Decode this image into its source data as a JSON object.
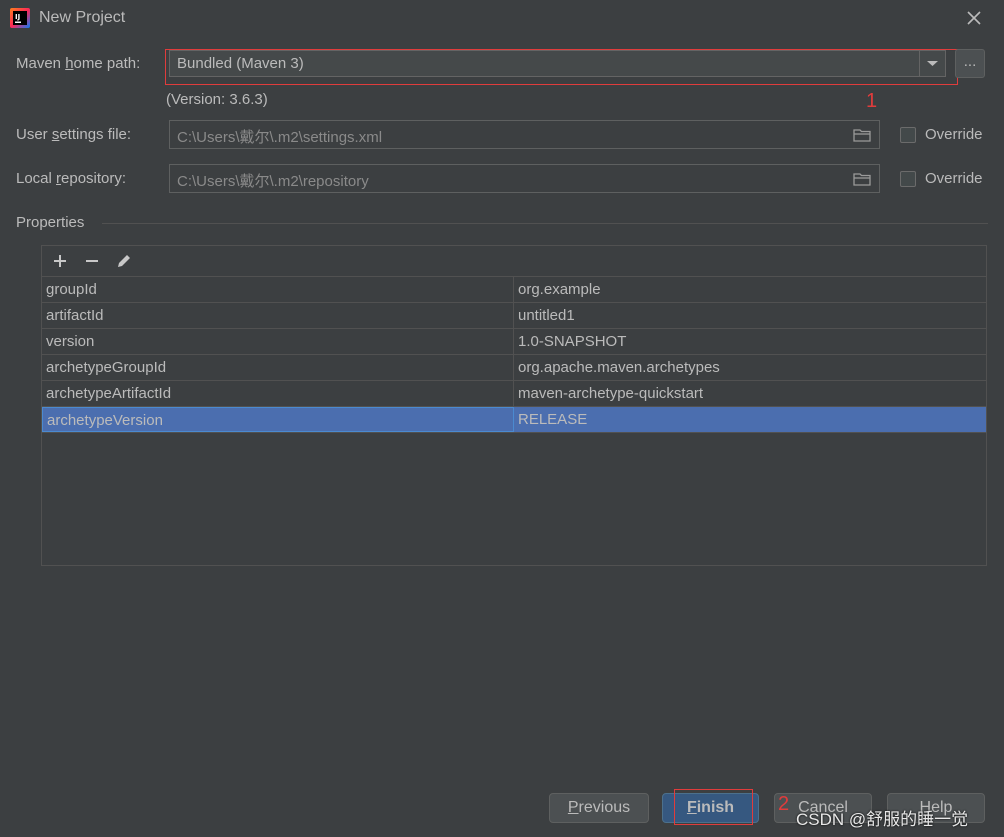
{
  "window": {
    "title": "New Project",
    "app_icon": "intellij-idea-icon",
    "close_icon": "close-icon"
  },
  "maven_home": {
    "label_pre": "Maven ",
    "label_mnemonic": "h",
    "label_post": "ome path:",
    "value": "Bundled (Maven 3)",
    "browse_label": "...",
    "version": "(Version: 3.6.3)"
  },
  "user_settings": {
    "label_pre": "User ",
    "label_mnemonic": "s",
    "label_post": "ettings file:",
    "value": "C:\\Users\\戴尔\\.m2\\settings.xml",
    "override_label": "Override",
    "override_checked": false
  },
  "local_repo": {
    "label_pre": "Local ",
    "label_mnemonic": "r",
    "label_post": "epository:",
    "value": "C:\\Users\\戴尔\\.m2\\repository",
    "override_label": "Override",
    "override_checked": false
  },
  "properties": {
    "title": "Properties",
    "toolbar": [
      "add-icon",
      "remove-icon",
      "edit-icon"
    ],
    "rows": [
      {
        "key": "groupId",
        "value": "org.example"
      },
      {
        "key": "artifactId",
        "value": "untitled1"
      },
      {
        "key": "version",
        "value": "1.0-SNAPSHOT"
      },
      {
        "key": "archetypeGroupId",
        "value": "org.apache.maven.archetypes"
      },
      {
        "key": "archetypeArtifactId",
        "value": "maven-archetype-quickstart"
      },
      {
        "key": "archetypeVersion",
        "value": "RELEASE"
      }
    ],
    "selected_row": 5
  },
  "annotations": {
    "one": "1",
    "two": "2",
    "color": "#e03c3c"
  },
  "buttons": {
    "previous": {
      "mnemonic": "P",
      "rest": "revious"
    },
    "finish": {
      "mnemonic": "F",
      "rest": "inish"
    },
    "cancel": "Cancel",
    "help": "Help"
  },
  "watermark": "CSDN @舒服的睡一觉",
  "colors": {
    "background": "#3c3f41",
    "selection": "#4b6eaf",
    "primary_button": "#365880",
    "text": "#bbbbbb"
  }
}
